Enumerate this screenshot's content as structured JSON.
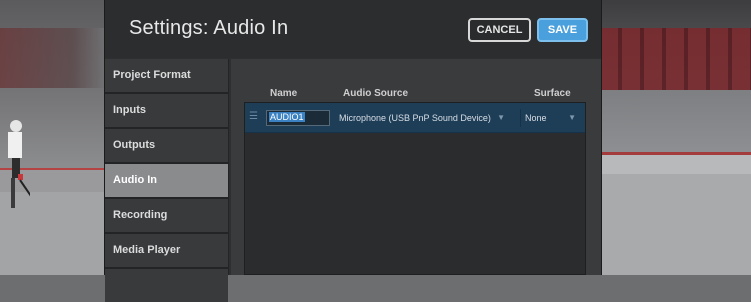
{
  "dialog": {
    "title": "Settings: Audio In",
    "cancel_label": "CANCEL",
    "save_label": "SAVE"
  },
  "sidebar": {
    "items": [
      {
        "label": "Project Format"
      },
      {
        "label": "Inputs"
      },
      {
        "label": "Outputs"
      },
      {
        "label": "Audio In",
        "active": true
      },
      {
        "label": "Recording"
      },
      {
        "label": "Media Player"
      }
    ]
  },
  "table": {
    "columns": [
      "Name",
      "Audio Source",
      "Surface"
    ],
    "rows": [
      {
        "name": "AUDIO1",
        "source": "Microphone (USB PnP Sound Device)",
        "surface": "None"
      }
    ]
  },
  "icons": {
    "drag_handle": "grip-lines-icon",
    "dropdown": "caret-down-icon"
  },
  "colors": {
    "accent": "#4aa0dd",
    "selected_row": "#1e3d57",
    "active_sidebar": "#8a8b8d"
  }
}
